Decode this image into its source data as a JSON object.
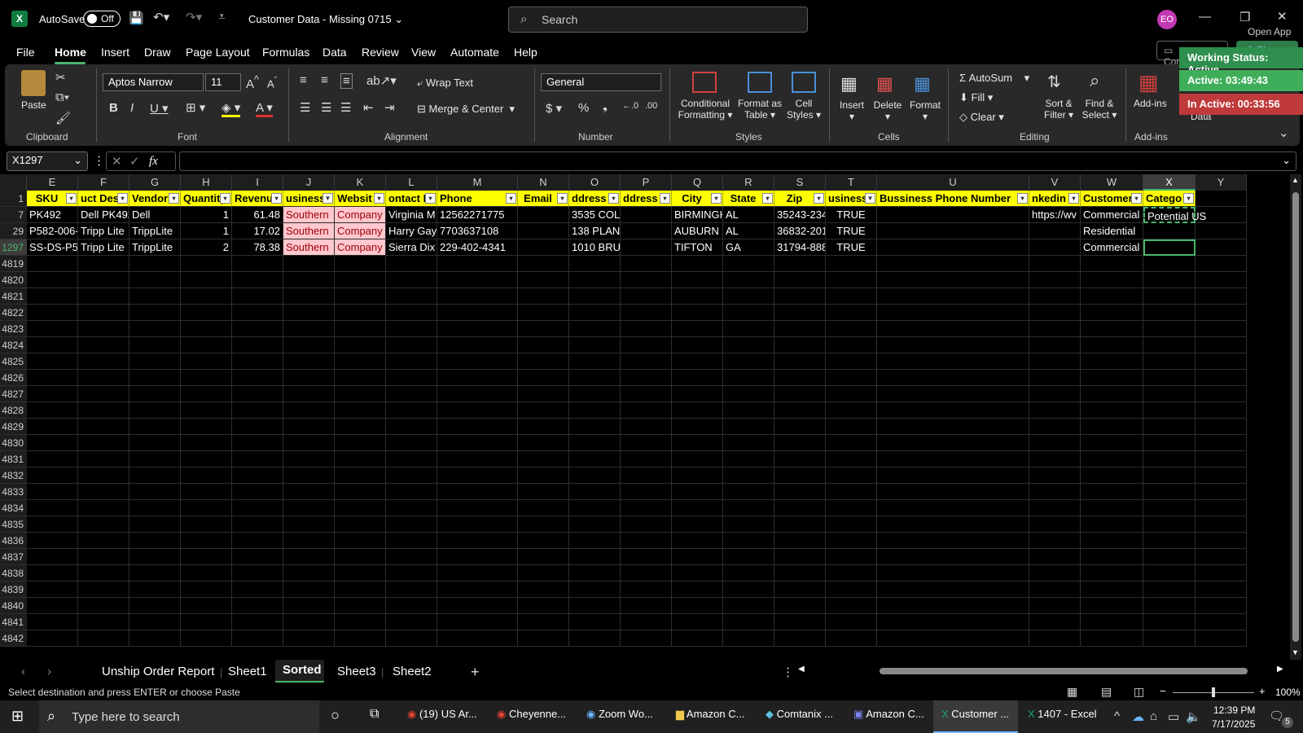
{
  "titlebar": {
    "autosave_label": "AutoSave",
    "autosave_state": "Off",
    "doc_title": "Customer Data - Missing 0715",
    "search_placeholder": "Search",
    "avatar_initials": "EO",
    "open_app": "Open App",
    "comments": "Comments",
    "share": "Share"
  },
  "menu": [
    "File",
    "Home",
    "Insert",
    "Draw",
    "Page Layout",
    "Formulas",
    "Data",
    "Review",
    "View",
    "Automate",
    "Help"
  ],
  "ribbon": {
    "paste": "Paste",
    "clipboard": "Clipboard",
    "font_name": "Aptos Narrow",
    "font_size": "11",
    "font_group": "Font",
    "wrap_text": "Wrap Text",
    "merge_center": "Merge & Center",
    "alignment": "Alignment",
    "number_format": "General",
    "number": "Number",
    "conditional": "Conditional",
    "formatting": "Formatting",
    "format_as": "Format as",
    "table": "Table",
    "cell": "Cell",
    "styles_btn": "Styles",
    "styles": "Styles",
    "insert": "Insert",
    "delete": "Delete",
    "format": "Format",
    "cells": "Cells",
    "autosum": "AutoSum",
    "fill": "Fill",
    "clear": "Clear",
    "sort_filter": "Sort &",
    "filter": "Filter",
    "find_select": "Find &",
    "select": "Select",
    "editing": "Editing",
    "addins": "Add-ins",
    "addins_group": "Add-ins",
    "data": "Data"
  },
  "namebox": "X1297",
  "fx": "fx",
  "columns": [
    {
      "letter": "E",
      "header": "SKU"
    },
    {
      "letter": "F",
      "header": "uct Des"
    },
    {
      "letter": "G",
      "header": "Vendor"
    },
    {
      "letter": "H",
      "header": "Quantity"
    },
    {
      "letter": "I",
      "header": "Revenu"
    },
    {
      "letter": "J",
      "header": "usiness I"
    },
    {
      "letter": "K",
      "header": "Websit"
    },
    {
      "letter": "L",
      "header": "ontact N"
    },
    {
      "letter": "M",
      "header": "Phone"
    },
    {
      "letter": "N",
      "header": "Email"
    },
    {
      "letter": "O",
      "header": "ddress L"
    },
    {
      "letter": "P",
      "header": "ddress L"
    },
    {
      "letter": "Q",
      "header": "City"
    },
    {
      "letter": "R",
      "header": "State"
    },
    {
      "letter": "S",
      "header": "Zip"
    },
    {
      "letter": "T",
      "header": "usiness"
    },
    {
      "letter": "U",
      "header": "Bussiness Phone Number"
    },
    {
      "letter": "V",
      "header": "nkedin P"
    },
    {
      "letter": "W",
      "header": "Customer T"
    },
    {
      "letter": "X",
      "header": "Catego"
    },
    {
      "letter": "Y",
      "header": ""
    }
  ],
  "rows": [
    {
      "num": "7",
      "cells": [
        "PK492",
        "Dell PK492",
        "Dell",
        "1",
        "61.48",
        "Southern",
        "Company",
        "Virginia M",
        "12562271775",
        "",
        "3535 COLC",
        "",
        "BIRMINGH",
        "AL",
        "35243-234",
        "TRUE",
        "",
        "https://wv",
        "Commercial",
        "Potential US",
        ""
      ]
    },
    {
      "num": "29",
      "cells": [
        "P582-006-",
        "Tripp Lite",
        "TrippLite",
        "1",
        "17.02",
        "Southern",
        "Company",
        "Harry Gay",
        "7703637108",
        "",
        "138 PLANT",
        "",
        "AUBURN",
        "AL",
        "36832-201",
        "TRUE",
        "",
        "",
        "Residential",
        "",
        ""
      ]
    },
    {
      "num": "1297",
      "cells": [
        "SS-DS-P58",
        "Tripp Lite",
        "TrippLite",
        "2",
        "78.38",
        "Southern",
        "Company",
        "Sierra Dix",
        "229-402-4341",
        "",
        "1010 BRUC",
        "",
        "TIFTON",
        "GA",
        "31794-888",
        "TRUE",
        "",
        "",
        "Commercial",
        "",
        ""
      ]
    }
  ],
  "empty_rows": [
    "4819",
    "4820",
    "4821",
    "4822",
    "4823",
    "4824",
    "4825",
    "4826",
    "4827",
    "4828",
    "4829",
    "4830",
    "4831",
    "4832",
    "4833",
    "4834",
    "4835",
    "4836",
    "4837",
    "4838",
    "4839",
    "4840",
    "4841",
    "4842"
  ],
  "header_row_num": "1",
  "sheet_tabs": [
    "Unship Order Report",
    "Sheet1",
    "Sorted",
    "Sheet3",
    "Sheet2"
  ],
  "active_sheet": "Sorted",
  "status_text": "Select destination and press ENTER or choose Paste",
  "zoom": "100%",
  "overlay": {
    "working_status": "Working Status: Active",
    "active": "Active: 03:49:43",
    "inactive": "In Active: 00:33:56"
  },
  "taskbar": {
    "search": "Type here to search",
    "items": [
      "(19) US Ar...",
      "Cheyenne...",
      "Zoom Wo...",
      "Amazon C...",
      "Comtanix ...",
      "Amazon C...",
      "Customer ...",
      "1407 - Excel"
    ],
    "time": "12:39 PM",
    "date": "7/17/2025",
    "notif": "5"
  },
  "colors": {
    "header_yellow": "#ffff00",
    "pink_fill": "#ffc7ce",
    "pink_text": "#9c0006",
    "active_green": "#3fae5a",
    "inactive_red": "#c0393b"
  }
}
